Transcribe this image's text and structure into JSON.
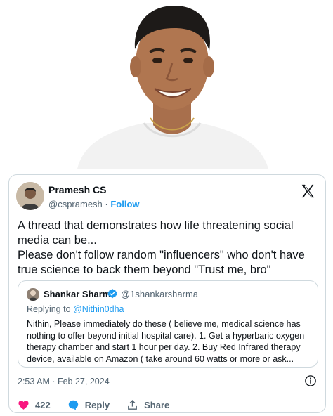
{
  "tweet": {
    "author_name": "Pramesh CS",
    "author_handle": "@cspramesh",
    "follow_label": "Follow",
    "text": "A thread that demonstrates how life threatening social media can be...\nPlease don't follow random \"influencers\" who don't have true science to back them beyond \"Trust me, bro\"",
    "timestamp": "2:53 AM · Feb 27, 2024",
    "like_count": "422",
    "reply_label": "Reply",
    "share_label": "Share"
  },
  "quote": {
    "author_name": "Shankar Sharma",
    "author_handle": "@1shankarsharma",
    "replying_prefix": "Replying to",
    "replying_to": "@Nithin0dha",
    "text": "Nithin, Please immediately do these ( believe me, medical science has nothing to offer beyond initial hospital care). 1. Get a hyperbaric oxygen therapy chamber and start 1 hour per day. 2. Buy Red Infrared therapy device, available on Amazon ( take around 60 watts or more or ask..."
  },
  "icons": {
    "brand": "x-logo-icon",
    "verified": "verified-badge-icon",
    "info": "info-icon",
    "like": "heart-icon",
    "reply": "reply-bubble-icon",
    "share": "share-icon"
  },
  "colors": {
    "link": "#1d9bf0",
    "like": "#f91880",
    "muted": "#536471",
    "border": "#cfd9de"
  }
}
